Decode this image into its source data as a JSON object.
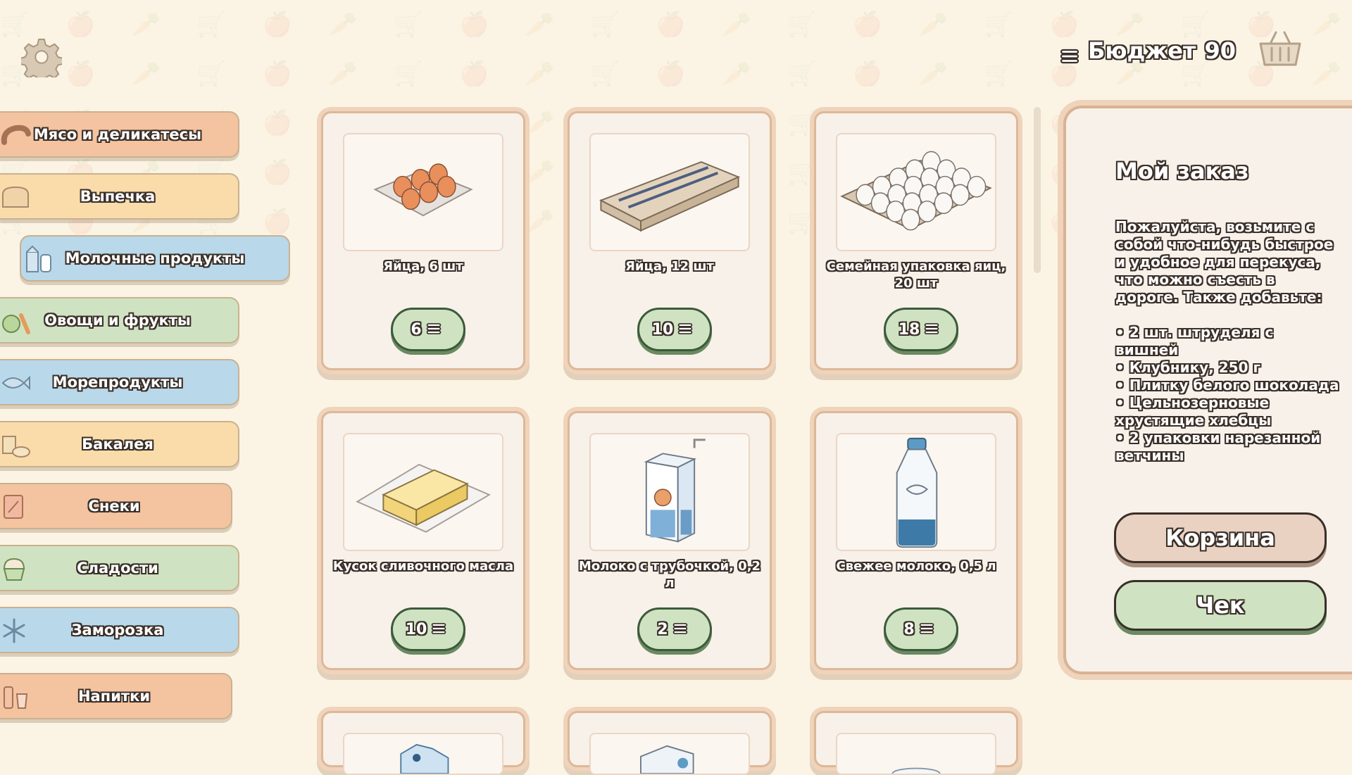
{
  "header": {
    "budget_label": "Бюджет",
    "budget_value": "90"
  },
  "categories": [
    {
      "label": "Мясо и деликатесы",
      "icon": "sausage-icon"
    },
    {
      "label": "Выпечка",
      "icon": "bread-icon"
    },
    {
      "label": "Молочные продукты",
      "icon": "milk-icon",
      "active": true
    },
    {
      "label": "Овощи и фрукты",
      "icon": "vegetables-icon"
    },
    {
      "label": "Морепродукты",
      "icon": "fish-icon"
    },
    {
      "label": "Бакалея",
      "icon": "grocery-icon"
    },
    {
      "label": "Снеки",
      "icon": "snacks-icon"
    },
    {
      "label": "Сладости",
      "icon": "cupcake-icon"
    },
    {
      "label": "Заморозка",
      "icon": "snowflake-icon"
    },
    {
      "label": "Напитки",
      "icon": "drinks-icon"
    }
  ],
  "products": [
    {
      "name": "Яйца, 6 шт",
      "price": "6"
    },
    {
      "name": "Яйца, 12 шт",
      "price": "10"
    },
    {
      "name": "Семейная упаковка яиц, 20 шт",
      "price": "18"
    },
    {
      "name": "Кусок сливочного масла",
      "price": "10"
    },
    {
      "name": "Молоко с трубочкой, 0,2 л",
      "price": "2"
    },
    {
      "name": "Свежее молоко, 0,5 л",
      "price": "8"
    }
  ],
  "order": {
    "title": "Мой заказ",
    "text": "Пожалуйста, возьмите с собой что-нибудь быстрое и удобное для перекуса, что можно съесть в дороге. Также добавьте:\n\n• 2 шт. штруделя с вишней\n• Клубнику, 250 г\n• Плитку белого шоколада\n• Цельнозерновые хрустящие хлебцы\n• 2 упаковки нарезанной ветчины",
    "cart_button": "Корзина",
    "check_button": "Чек"
  },
  "colors": {
    "background": "#fbf4e4",
    "card_border": "#ddb898",
    "price_button": "#cfe3c2",
    "category_orange": "#f4c3a0",
    "category_yellow": "#f9dcaa",
    "category_blue": "#b9d8ea",
    "category_green": "#cfe3c2"
  }
}
